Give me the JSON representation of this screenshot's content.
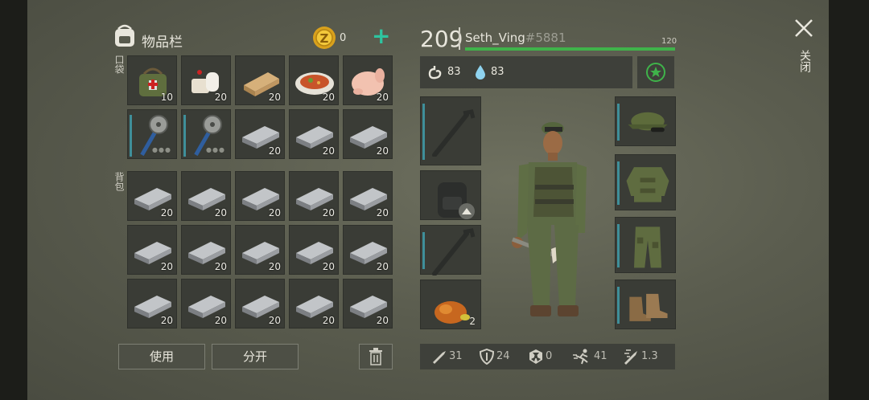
{
  "header": {
    "inventory_title": "物品栏",
    "coin_count": "0",
    "level": "209",
    "player_name": "Seth_Ving",
    "player_tag": "#5881",
    "xp_max": "120",
    "xp_progress": 1.0
  },
  "side_labels": {
    "pockets": "口袋",
    "backpack": "背包"
  },
  "vitals": {
    "food": "83",
    "water": "83"
  },
  "close": {
    "label": "关闭"
  },
  "actions": {
    "use": "使用",
    "split": "分开"
  },
  "pockets": [
    {
      "icon": "first-aid-bag-icon",
      "qty": "10"
    },
    {
      "icon": "bandage-icon",
      "qty": "20"
    },
    {
      "icon": "wood-plank-icon",
      "qty": "20"
    },
    {
      "icon": "cooked-meal-icon",
      "qty": "20"
    },
    {
      "icon": "raw-chicken-icon",
      "qty": "20"
    }
  ],
  "pocket_row2": [
    {
      "icon": "saw-blade-club-icon",
      "qty": ""
    },
    {
      "icon": "saw-blade-club-icon",
      "qty": ""
    },
    {
      "icon": "iron-bar-icon",
      "qty": "20"
    },
    {
      "icon": "iron-bar-icon",
      "qty": "20"
    },
    {
      "icon": "iron-bar-icon",
      "qty": "20"
    }
  ],
  "backpack": [
    "20",
    "20",
    "20",
    "20",
    "20",
    "20",
    "20",
    "20",
    "20",
    "20",
    "20",
    "20",
    "20",
    "20",
    "20"
  ],
  "equipment_left": [
    {
      "icon": "crowbar-icon",
      "qty": ""
    },
    {
      "icon": "backpack-icon",
      "qty": ""
    },
    {
      "icon": "crowbar-icon",
      "qty": ""
    },
    {
      "icon": "roast-chicken-icon",
      "qty": "2"
    }
  ],
  "equipment_right": [
    {
      "icon": "military-cap-icon"
    },
    {
      "icon": "camo-jacket-icon"
    },
    {
      "icon": "camo-pants-icon"
    },
    {
      "icon": "boots-icon"
    }
  ],
  "stats": {
    "damage": "31",
    "armor": "24",
    "radiation": "0",
    "speed": "41",
    "attack_speed": "1.3"
  },
  "colors": {
    "xp_bar": "#3fb34a",
    "accent_teal": "#3f8f9a",
    "plus": "#2ec4a0"
  }
}
